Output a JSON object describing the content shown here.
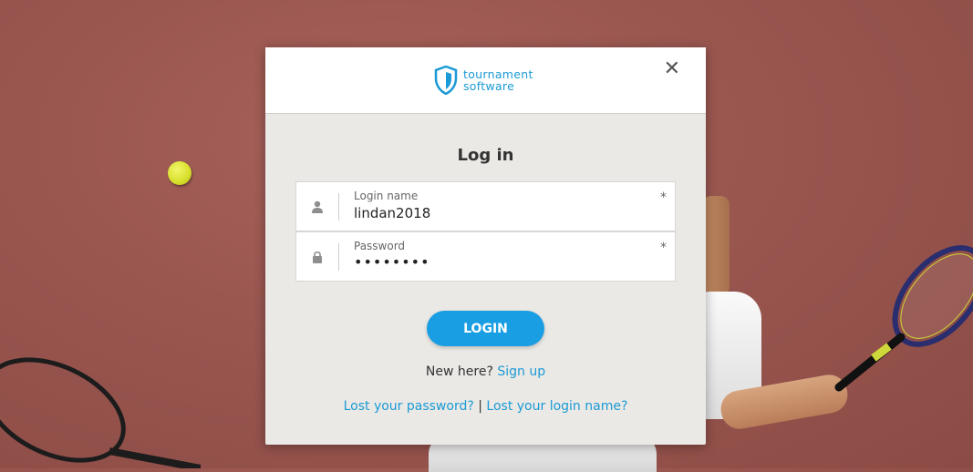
{
  "brand": {
    "line1": "tournament",
    "line2": "software",
    "color": "#1a9ad6"
  },
  "modal": {
    "title": "Log in",
    "close_glyph": "✕"
  },
  "fields": {
    "login_name": {
      "label": "Login name",
      "value": "lindan2018",
      "required_mark": "*",
      "icon": "user-icon"
    },
    "password": {
      "label": "Password",
      "value": "••••••••",
      "required_mark": "*",
      "icon": "lock-icon"
    }
  },
  "actions": {
    "login_label": "LOGIN",
    "login_color": "#1a9ee3",
    "new_here_text": "New here?",
    "sign_up_label": "Sign up",
    "lost_password_label": "Lost your password?",
    "separator": "|",
    "lost_login_label": "Lost your login name?"
  }
}
